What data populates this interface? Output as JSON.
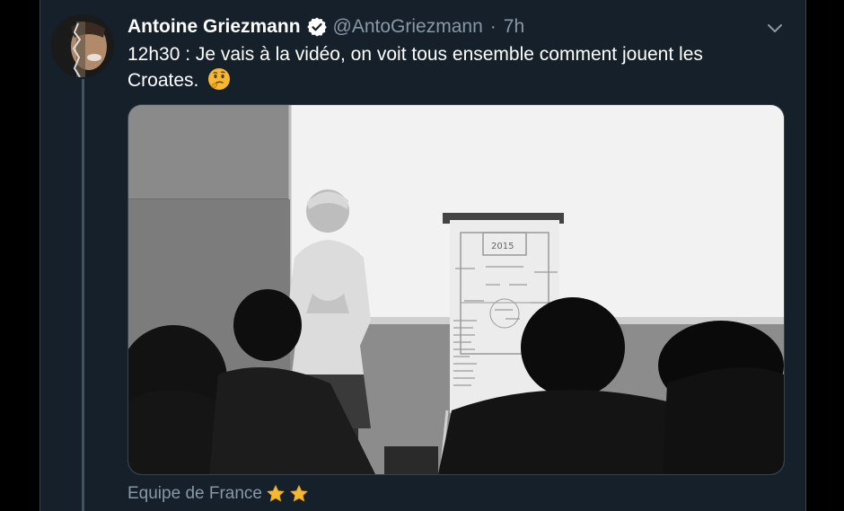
{
  "tweet": {
    "author_name": "Antoine Griezmann",
    "handle": "@AntoGriezmann",
    "separator": "·",
    "time": "7h",
    "text": "12h30 : Je vais à la vidéo, on voit tous ensemble comment jouent les Croates.",
    "emoji": "thinking-face",
    "footer_label": "Equipe de France",
    "footer_emoji": [
      "star",
      "star"
    ]
  },
  "media": {
    "board_sheet_text": "2015"
  },
  "icons": {
    "verified": "verified-badge-icon",
    "caret": "chevron-down-icon"
  },
  "colors": {
    "background": "#15202b",
    "secondary_text": "#8899a6",
    "primary_text": "#ffffff",
    "border": "#38444d"
  }
}
